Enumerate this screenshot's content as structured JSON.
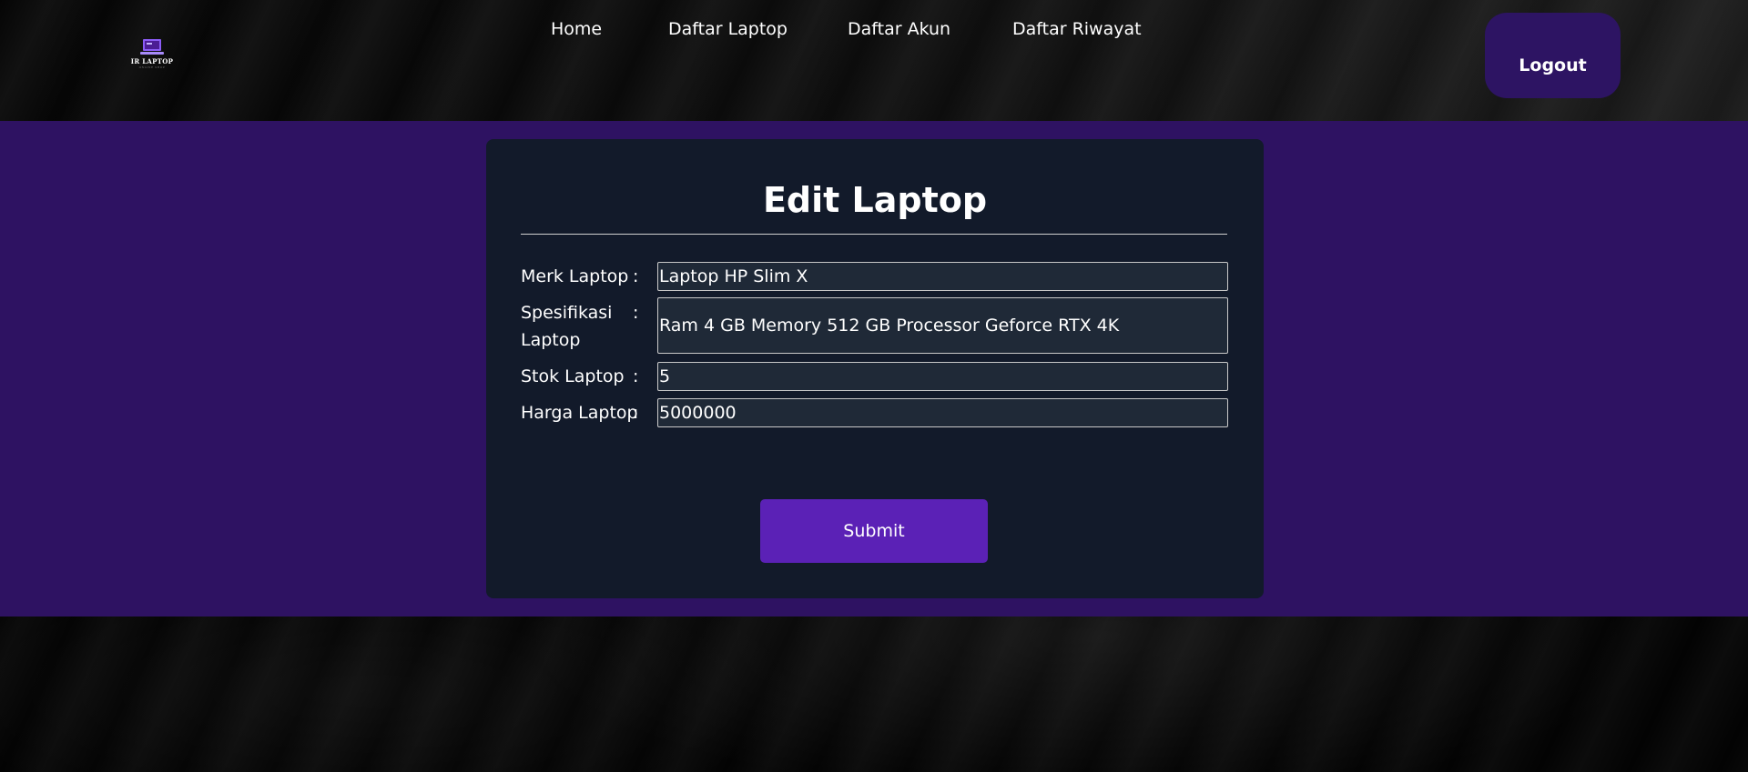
{
  "brand": {
    "logo_text": "IR LAPTOP",
    "logo_sub": "ONLINE SHOP",
    "icon": "laptop-icon",
    "accent_color": "#5b21b6"
  },
  "nav": {
    "items": [
      "Home",
      "Daftar Laptop",
      "Daftar Akun",
      "Daftar Riwayat"
    ],
    "logout_label": "Logout"
  },
  "form": {
    "title": "Edit Laptop",
    "fields": [
      {
        "label": "Merk Laptop",
        "colon": ":",
        "value": "Laptop HP Slim X"
      },
      {
        "label": "Spesifikasi Laptop",
        "colon": ":",
        "value": "Ram 4 GB Memory 512 GB Processor Geforce RTX 4K"
      },
      {
        "label": "Stok Laptop",
        "colon": ":",
        "value": "5"
      },
      {
        "label": "Harga Laptop",
        "colon": ":",
        "value": "5000000"
      }
    ],
    "submit_label": "Submit"
  }
}
